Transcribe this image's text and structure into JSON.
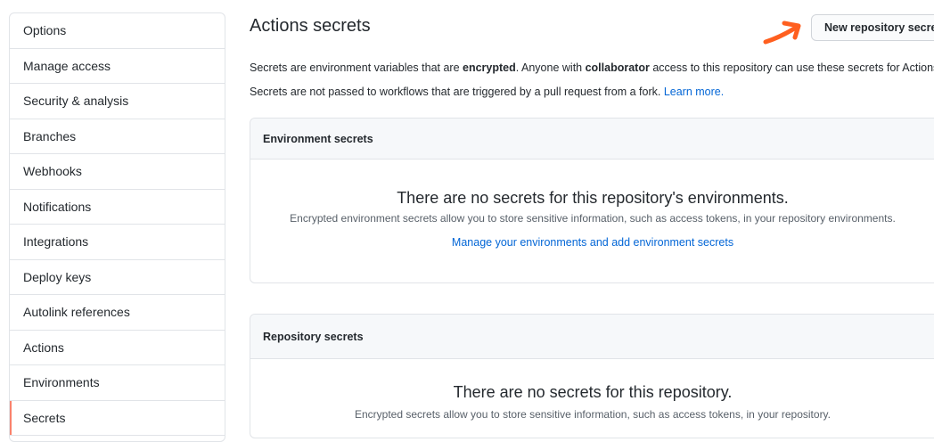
{
  "sidebar": {
    "items": [
      {
        "label": "Options"
      },
      {
        "label": "Manage access"
      },
      {
        "label": "Security & analysis"
      },
      {
        "label": "Branches"
      },
      {
        "label": "Webhooks"
      },
      {
        "label": "Notifications"
      },
      {
        "label": "Integrations"
      },
      {
        "label": "Deploy keys"
      },
      {
        "label": "Autolink references"
      },
      {
        "label": "Actions"
      },
      {
        "label": "Environments"
      },
      {
        "label": "Secrets"
      }
    ],
    "selected": "Secrets",
    "accent_color": "#f9826c"
  },
  "header": {
    "title": "Actions secrets",
    "new_button_label": "New repository secret"
  },
  "description": {
    "line1_part1": "Secrets are environment variables that are ",
    "line1_bold1": "encrypted",
    "line1_part2": ". Anyone with ",
    "line1_bold2": "collaborator",
    "line1_part3": " access to this repository can use these secrets for Actions.",
    "line2_text": "Secrets are not passed to workflows that are triggered by a pull request from a fork. ",
    "line2_link": "Learn more."
  },
  "environment_secrets": {
    "header": "Environment secrets",
    "empty_title": "There are no secrets for this repository's environments.",
    "empty_desc": "Encrypted environment secrets allow you to store sensitive information, such as access tokens, in your repository environments.",
    "link": "Manage your environments and add environment secrets"
  },
  "repository_secrets": {
    "header": "Repository secrets",
    "empty_title": "There are no secrets for this repository.",
    "empty_desc": "Encrypted secrets allow you to store sensitive information, such as access tokens, in your repository."
  },
  "annotation": {
    "arrow_color": "#ff5f1f",
    "arrow_icon": "arrow-right-icon"
  }
}
